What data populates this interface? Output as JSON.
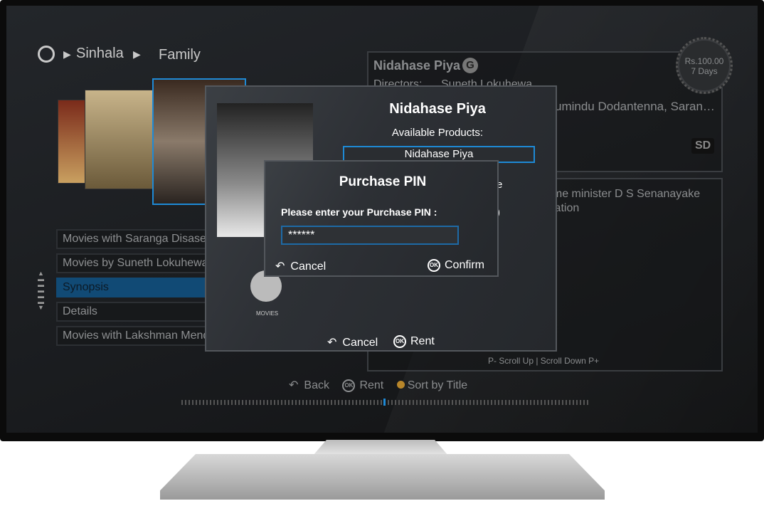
{
  "breadcrumb": [
    "Sinhala",
    "Family"
  ],
  "info": {
    "title": "Nidahase Piya",
    "rating": "G",
    "directors_label": "Directors:",
    "directors": "Suneth Lokuhewa",
    "cast_partial": "umindu Dodantenna, Saran…",
    "quality": "SD",
    "price": "Rs.100.00",
    "duration": "7 Days"
  },
  "synopsis": {
    "line1": "rime minister D S Senanayake",
    "line2": "Nation",
    "scroll_hint": "P- Scroll Up | Scroll Down P+"
  },
  "list": [
    {
      "label": "Movies with Saranga Disasekara"
    },
    {
      "label": "Movies by Suneth Lokuhewa"
    },
    {
      "label": "Synopsis",
      "selected": true
    },
    {
      "label": "Details"
    },
    {
      "label": "Movies with Lakshman Mendis"
    }
  ],
  "rent_dialog": {
    "title": "Nidahase Piya",
    "products_label": "Available Products:",
    "product": "Nidahase Piya",
    "behind1": "e",
    "behind2": ")",
    "category": "MOVIES",
    "cancel": "Cancel",
    "rent": "Rent",
    "ok_glyph": "OK"
  },
  "pin_dialog": {
    "title": "Purchase PIN",
    "prompt": "Please enter your Purchase PIN :",
    "value": "******",
    "cancel": "Cancel",
    "confirm": "Confirm"
  },
  "hints": {
    "back": "Back",
    "rent": "Rent",
    "sort": "Sort by Title"
  },
  "colors": {
    "accent": "#1e8ad6",
    "selected": "#114a75",
    "sort_dot": "#b8862a"
  }
}
